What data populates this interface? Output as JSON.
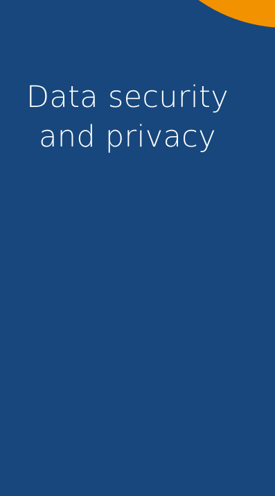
{
  "screen": {
    "background_color": "#17477d",
    "accent_color": "#f39200"
  },
  "decoration": {
    "accent_shape_name": "orange-quarter-circle"
  },
  "content": {
    "title_line_1": "Data security",
    "title_line_2": "and privacy"
  }
}
